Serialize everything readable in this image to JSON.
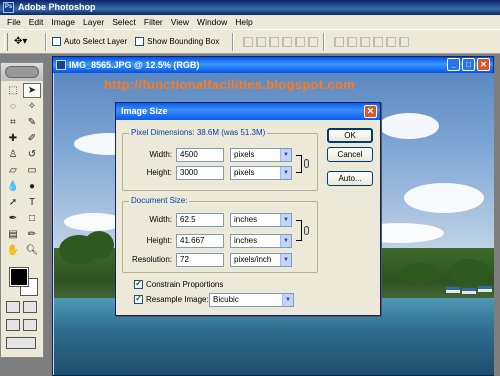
{
  "app": {
    "title": "Adobe Photoshop"
  },
  "menu": [
    "File",
    "Edit",
    "Image",
    "Layer",
    "Select",
    "Filter",
    "View",
    "Window",
    "Help"
  ],
  "options_bar": {
    "auto_select_layer": {
      "label": "Auto Select Layer",
      "checked": false
    },
    "show_bounding_box": {
      "label": "Show Bounding Box",
      "checked": false
    }
  },
  "document": {
    "title": "IMG_8565.JPG @ 12.5% (RGB)",
    "watermark": "http://functionalfacilities.blogspot.com"
  },
  "dialog": {
    "title": "Image Size",
    "pixel_dimensions": {
      "label": "Pixel Dimensions:",
      "size_note": "38.6M (was 51.3M)",
      "width_label": "Width:",
      "width_value": "4500",
      "width_unit": "pixels",
      "height_label": "Height:",
      "height_value": "3000",
      "height_unit": "pixels"
    },
    "document_size": {
      "label": "Document Size:",
      "width_label": "Width:",
      "width_value": "62.5",
      "width_unit": "inches",
      "height_label": "Height:",
      "height_value": "41.667",
      "height_unit": "inches",
      "resolution_label": "Resolution:",
      "resolution_value": "72",
      "resolution_unit": "pixels/inch"
    },
    "constrain_proportions": {
      "label": "Constrain Proportions",
      "checked": true
    },
    "resample_image": {
      "label": "Resample Image:",
      "checked": true,
      "method": "Bicubic"
    },
    "buttons": {
      "ok": "OK",
      "cancel": "Cancel",
      "auto": "Auto..."
    }
  },
  "colors": {
    "foreground": "#000000",
    "background": "#ffffff",
    "accent": "#0054e3"
  }
}
